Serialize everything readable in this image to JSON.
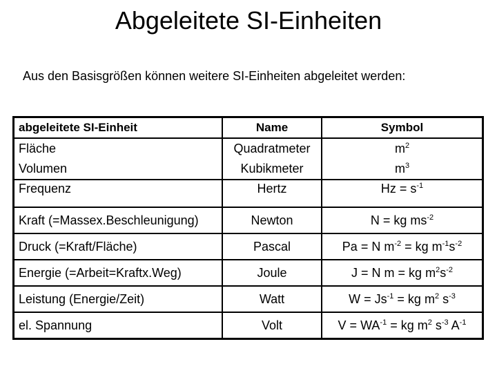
{
  "page": {
    "title": "Abgeleitete SI-Einheiten",
    "subtitle": "Aus den Basisgrößen können weitere SI-Einheiten abgeleitet werden:"
  },
  "table": {
    "headers": {
      "unit": "abgeleitete SI-Einheit",
      "name": "Name",
      "symbol": "Symbol"
    },
    "rows": [
      {
        "units": [
          "Fläche",
          "Volumen"
        ],
        "names": [
          "Quadratmeter",
          "Kubikmeter"
        ],
        "symbols": [
          [
            {
              "t": "m",
              "sup": "2"
            }
          ],
          [
            {
              "t": "m",
              "sup": "3"
            }
          ]
        ]
      },
      {
        "units": [
          "Frequenz"
        ],
        "names": [
          "Hertz"
        ],
        "symbols": [
          [
            {
              "t": "Hz = s",
              "sup": "-1"
            }
          ]
        ]
      },
      {
        "units": [
          "Kraft (=Massex.Beschleunigung)"
        ],
        "names": [
          "Newton"
        ],
        "symbols": [
          [
            {
              "t": "N = kg ms",
              "sup": "-2"
            }
          ]
        ]
      },
      {
        "units": [
          "Druck (=Kraft/Fläche)"
        ],
        "names": [
          "Pascal"
        ],
        "symbols": [
          [
            {
              "t": "Pa = N m",
              "sup": "-2"
            },
            {
              "t": " = kg m",
              "sup": "-1"
            },
            {
              "t": "s",
              "sup": "-2"
            }
          ]
        ]
      },
      {
        "units": [
          "Energie (=Arbeit=Kraftx.Weg)"
        ],
        "names": [
          "Joule"
        ],
        "symbols": [
          [
            {
              "t": "J = N m = kg m",
              "sup": "2"
            },
            {
              "t": "s",
              "sup": "-2"
            }
          ]
        ]
      },
      {
        "units": [
          "Leistung (Energie/Zeit)"
        ],
        "names": [
          "Watt"
        ],
        "symbols": [
          [
            {
              "t": "W = Js",
              "sup": "-1"
            },
            {
              "t": " = kg m",
              "sup": "2"
            },
            {
              "t": " s",
              "sup": "-3"
            }
          ]
        ]
      },
      {
        "units": [
          "el. Spannung"
        ],
        "names": [
          "Volt"
        ],
        "symbols": [
          [
            {
              "t": "V = WA",
              "sup": "-1"
            },
            {
              "t": " = kg m",
              "sup": "2"
            },
            {
              "t": " s",
              "sup": "-3"
            },
            {
              "t": " A",
              "sup": "-1"
            }
          ]
        ]
      }
    ]
  }
}
